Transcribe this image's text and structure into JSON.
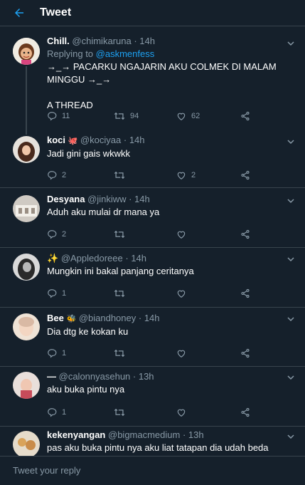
{
  "header": {
    "title": "Tweet"
  },
  "tweets": [
    {
      "name": "Chill.",
      "handle": "@chimikaruna",
      "time": "· 14h",
      "replying_prefix": "Replying to",
      "replying_to": "@askmenfess",
      "text": "→_→ PACARKU NGAJARIN AKU COLMEK DI MALAM\nMINGGU →_→\n\nA THREAD",
      "replies": "11",
      "retweets": "94",
      "likes": "62"
    },
    {
      "name": "koci",
      "handle": "@kociyaa",
      "time": "· 14h",
      "text": "Jadi gini gais wkwkk",
      "replies": "2",
      "retweets": "",
      "likes": "2"
    },
    {
      "name": "Desyana",
      "handle": "@jinkiww",
      "time": "· 14h",
      "text": "Aduh aku mulai dr mana ya",
      "replies": "2",
      "retweets": "",
      "likes": ""
    },
    {
      "name": "✨",
      "handle": "@Appledoreee",
      "time": "· 14h",
      "text": "Mungkin ini bakal panjang ceritanya",
      "replies": "1",
      "retweets": "",
      "likes": ""
    },
    {
      "name": "Bee",
      "handle": "@biandhoney",
      "time": "· 14h",
      "text": "Dia dtg ke kokan ku",
      "replies": "1",
      "retweets": "",
      "likes": ""
    },
    {
      "name": "—",
      "handle": "@calonnyasehun",
      "time": "· 13h",
      "text": "aku buka pintu nya",
      "replies": "1",
      "retweets": "",
      "likes": ""
    },
    {
      "name": "kekenyangan",
      "handle": "@bigmacmedium",
      "time": "· 13h",
      "text": "pas aku buka pintu nya aku liat tatapan dia udah beda"
    }
  ],
  "reply_bar": {
    "placeholder": "Tweet your reply"
  },
  "colors": {
    "background": "#15202b",
    "divider": "#38444d",
    "secondary_text": "#8899a6",
    "accent": "#1da1f2"
  }
}
